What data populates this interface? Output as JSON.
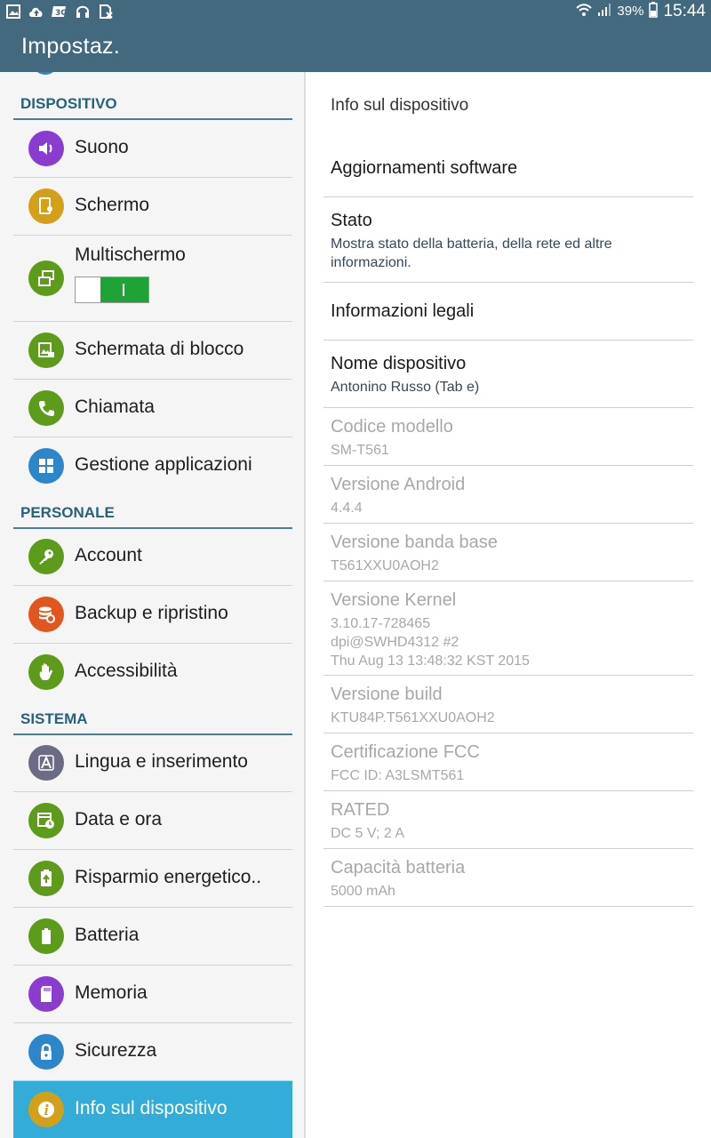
{
  "status_bar": {
    "left_icons": [
      "image-icon",
      "cloud-upload-icon",
      "sim-3g-icon",
      "headset-icon",
      "no-sim-icon"
    ],
    "battery_percent": "39%",
    "time": "15:44"
  },
  "action_bar": {
    "title": "Impostaz."
  },
  "sidebar": {
    "sections": [
      {
        "title": "DISPOSITIVO"
      },
      {
        "title": "PERSONALE"
      },
      {
        "title": "SISTEMA"
      }
    ],
    "items": [
      {
        "label": "Suono",
        "icon": "speaker-icon",
        "color": "#8a3ccf"
      },
      {
        "label": "Schermo",
        "icon": "display-icon",
        "color": "#d4a017"
      },
      {
        "label": "Multischermo",
        "icon": "multiwindow-icon",
        "color": "#5d9b1a",
        "toggle": "on"
      },
      {
        "label": "Schermata di blocco",
        "icon": "lock-screen-icon",
        "color": "#5d9b1a"
      },
      {
        "label": "Chiamata",
        "icon": "phone-icon",
        "color": "#5d9b1a"
      },
      {
        "label": "Gestione applicazioni",
        "icon": "apps-grid-icon",
        "color": "#2b87c9"
      },
      {
        "label": "Account",
        "icon": "key-icon",
        "color": "#5d9b1a"
      },
      {
        "label": "Backup e ripristino",
        "icon": "backup-icon",
        "color": "#e0561c"
      },
      {
        "label": "Accessibilità",
        "icon": "hand-icon",
        "color": "#5d9b1a"
      },
      {
        "label": "Lingua e inserimento",
        "icon": "language-icon",
        "color": "#6b6b85"
      },
      {
        "label": "Data e ora",
        "icon": "calendar-clock-icon",
        "color": "#5d9b1a"
      },
      {
        "label": "Risparmio energetico..",
        "icon": "power-saving-icon",
        "color": "#5d9b1a"
      },
      {
        "label": "Batteria",
        "icon": "battery-icon",
        "color": "#5d9b1a"
      },
      {
        "label": "Memoria",
        "icon": "memory-card-icon",
        "color": "#8a3ccf"
      },
      {
        "label": "Sicurezza",
        "icon": "padlock-icon",
        "color": "#2b87c9"
      },
      {
        "label": "Info sul dispositivo",
        "icon": "info-icon",
        "color": "#d4a017",
        "selected": true
      }
    ]
  },
  "detail": {
    "header": "Info sul dispositivo",
    "items": [
      {
        "title": "Aggiornamenti software",
        "subtitle": ""
      },
      {
        "title": "Stato",
        "subtitle": "Mostra stato della batteria, della rete ed altre informazioni."
      },
      {
        "title": "Informazioni legali",
        "subtitle": ""
      },
      {
        "title": "Nome dispositivo",
        "subtitle": "Antonino Russo (Tab e)"
      },
      {
        "title": "Codice modello",
        "subtitle": "SM-T561"
      },
      {
        "title": "Versione Android",
        "subtitle": "4.4.4"
      },
      {
        "title": "Versione banda base",
        "subtitle": "T561XXU0AOH2"
      },
      {
        "title": "Versione Kernel",
        "subtitle_lines": [
          "3.10.17-728465",
          "dpi@SWHD4312 #2",
          "Thu Aug 13 13:48:32 KST 2015"
        ]
      },
      {
        "title": "Versione build",
        "subtitle": "KTU84P.T561XXU0AOH2"
      },
      {
        "title": "Certificazione FCC",
        "subtitle": "FCC ID: A3LSMT561"
      },
      {
        "title": "RATED",
        "subtitle": "DC 5 V; 2 A"
      },
      {
        "title": "Capacità batteria",
        "subtitle": "5000 mAh"
      }
    ]
  }
}
